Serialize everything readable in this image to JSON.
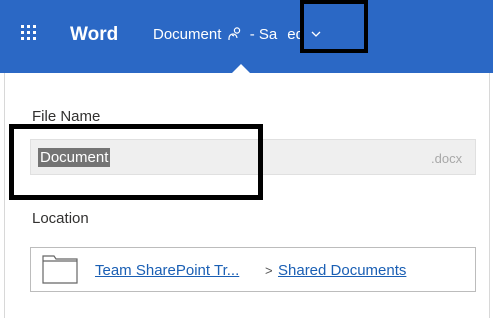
{
  "header": {
    "app_name": "Word",
    "document_title": "Document",
    "status_separator": "- Sa",
    "status_tail": "ed",
    "shared_icon": "people-icon",
    "menu_icon": "waffle-icon",
    "dropdown_icon": "chevron-down-icon",
    "background_color": "#2b68c5"
  },
  "file_name": {
    "label": "File Name",
    "value": "Document",
    "extension": ".docx"
  },
  "location": {
    "label": "Location",
    "folder_icon": "folder-icon",
    "breadcrumb": [
      "Team SharePoint Tr...",
      "Shared Documents"
    ],
    "separator": ">"
  }
}
